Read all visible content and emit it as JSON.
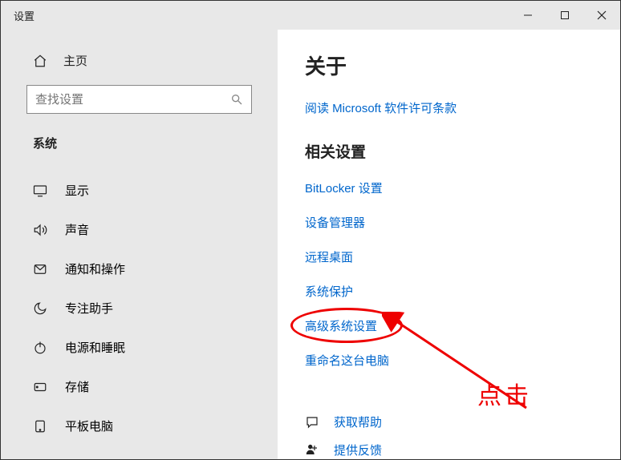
{
  "window": {
    "title": "设置"
  },
  "sidebar": {
    "home": "主页",
    "search_placeholder": "查找设置",
    "section": "系统",
    "items": [
      {
        "label": "显示"
      },
      {
        "label": "声音"
      },
      {
        "label": "通知和操作"
      },
      {
        "label": "专注助手"
      },
      {
        "label": "电源和睡眠"
      },
      {
        "label": "存储"
      },
      {
        "label": "平板电脑"
      }
    ]
  },
  "main": {
    "title": "关于",
    "license_link": "阅读 Microsoft 软件许可条款",
    "related_heading": "相关设置",
    "related_links": [
      "BitLocker 设置",
      "设备管理器",
      "远程桌面",
      "系统保护",
      "高级系统设置",
      "重命名这台电脑"
    ],
    "get_help": "获取帮助",
    "feedback": "提供反馈"
  },
  "annotation": {
    "text": "点击"
  }
}
